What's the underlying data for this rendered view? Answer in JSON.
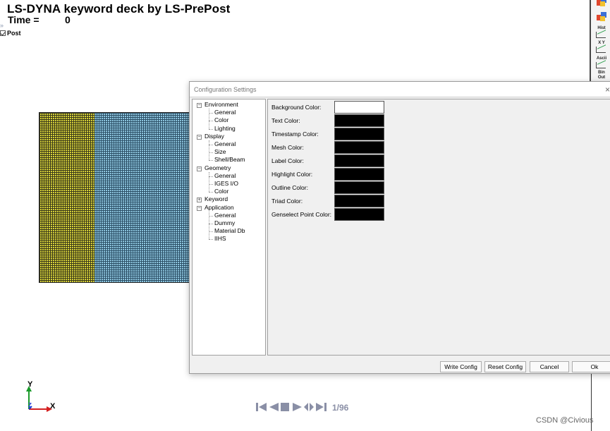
{
  "viewport": {
    "title": "LS-DYNA keyword deck by LS-PrePost",
    "time_label": "Time =",
    "time_value": "0",
    "chevron": "»",
    "post_label": "Post",
    "post_checked": true
  },
  "right_toolbar": {
    "buttons": [
      {
        "icon": "cube-icon",
        "label": ""
      },
      {
        "icon": "cube-icon",
        "label": ""
      },
      {
        "icon": "history-chart-icon",
        "label": "Hist"
      },
      {
        "icon": "xy-plot-icon",
        "label": "X Y"
      },
      {
        "icon": "ascii-chart-icon",
        "label": "Ascii"
      },
      {
        "icon": "binout-icon",
        "label": "Bin Out"
      }
    ]
  },
  "dialog": {
    "title": "Configuration Settings",
    "close_glyph": "×",
    "tree": [
      {
        "label": "Environment",
        "level": 0,
        "expander": "⊟"
      },
      {
        "label": "General",
        "level": 1
      },
      {
        "label": "Color",
        "level": 1
      },
      {
        "label": "Lighting",
        "level": 1
      },
      {
        "label": "Display",
        "level": 0,
        "expander": "⊟"
      },
      {
        "label": "General",
        "level": 1
      },
      {
        "label": "Size",
        "level": 1
      },
      {
        "label": "Shell/Beam",
        "level": 1
      },
      {
        "label": "Geometry",
        "level": 0,
        "expander": "⊟"
      },
      {
        "label": "General",
        "level": 1
      },
      {
        "label": "IGES I/O",
        "level": 1
      },
      {
        "label": "Color",
        "level": 1
      },
      {
        "label": "Keyword",
        "level": 0,
        "expander": "⊞"
      },
      {
        "label": "Application",
        "level": 0,
        "expander": "⊟"
      },
      {
        "label": "General",
        "level": 1
      },
      {
        "label": "Dummy",
        "level": 1
      },
      {
        "label": "Material Db",
        "level": 1
      },
      {
        "label": "IIHS",
        "level": 1
      }
    ],
    "color_rows": [
      {
        "label": "Background Color:",
        "color": "#ffffff"
      },
      {
        "label": "Text Color:",
        "color": "#000000"
      },
      {
        "label": "Timestamp Color:",
        "color": "#000000"
      },
      {
        "label": "Mesh Color:",
        "color": "#000000"
      },
      {
        "label": "Label Color:",
        "color": "#000000"
      },
      {
        "label": "Highlight Color:",
        "color": "#000000"
      },
      {
        "label": "Outline Color:",
        "color": "#000000"
      },
      {
        "label": "Triad Color:",
        "color": "#000000"
      },
      {
        "label": "Genselect Point Color:",
        "color": "#000000"
      }
    ],
    "buttons": {
      "write_config": "Write Config",
      "reset_config": "Reset Config",
      "cancel": "Cancel",
      "ok": "Ok"
    }
  },
  "mesh": {
    "left_part_color": "#d8d23a",
    "right_part_color": "#8fc7e0"
  },
  "axes": {
    "y_label": "Y",
    "x_label": "X",
    "z_label": "Z"
  },
  "playback": {
    "controls": [
      "first-frame-icon",
      "previous-frame-icon",
      "stop-icon",
      "play-icon",
      "loop-icon",
      "last-frame-icon"
    ],
    "frame_counter": "1/96"
  },
  "watermark": "CSDN @Civious"
}
